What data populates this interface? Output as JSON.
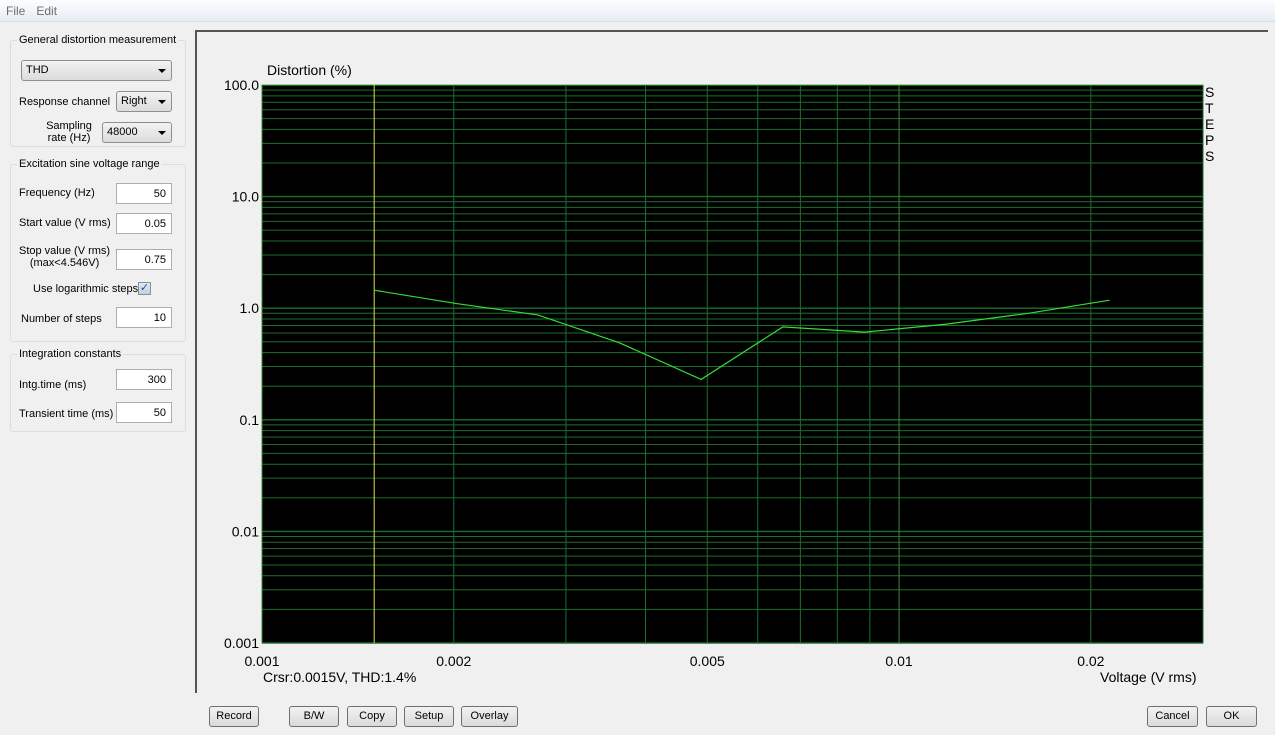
{
  "menu": [
    "File",
    "Edit"
  ],
  "general": {
    "title": "General distortion measurement",
    "mode": "THD",
    "response_label": "Response channel",
    "response_value": "Right",
    "sampling_label_1": "Sampling",
    "sampling_label_2": "rate (Hz)",
    "sampling_value": "48000"
  },
  "excitation": {
    "title": "Excitation sine voltage range",
    "freq_label": "Frequency (Hz)",
    "freq_value": "50",
    "start_label": "Start value (V rms)",
    "start_value": "0.05",
    "stop_label_1": "Stop value (V rms)",
    "stop_label_2": "(max<4.546V)",
    "stop_value": "0.75",
    "log_label": "Use logarithmic steps",
    "log_checked": true,
    "steps_label": "Number of steps",
    "steps_value": "10"
  },
  "integration": {
    "title": "Integration constants",
    "intg_label": "Intg.time (ms)",
    "intg_value": "300",
    "transient_label": "Transient time (ms)",
    "transient_value": "50"
  },
  "buttons": {
    "record": "Record",
    "bw": "B/W",
    "copy": "Copy",
    "setup": "Setup",
    "overlay": "Overlay",
    "cancel": "Cancel",
    "ok": "OK"
  },
  "plot": {
    "side_label": "STEPS",
    "cursor_text": "Crsr:0.0015V, THD:1.4%"
  },
  "chart_data": {
    "type": "line",
    "ylabel": "Distortion (%)",
    "xlabel": "Voltage (V rms)",
    "xscale": "log",
    "yscale": "log",
    "xlim": [
      0.001,
      0.03
    ],
    "ylim": [
      0.001,
      100
    ],
    "xticks": [
      "0.001",
      "0.002",
      "0.005",
      "0.01",
      "0.02"
    ],
    "yticks": [
      "100.0",
      "10.0",
      "1.0",
      "0.1",
      "0.01",
      "0.001"
    ],
    "grid": true,
    "background": "#000000",
    "line_color": "#33dd33",
    "grid_color": "#1e6e2e",
    "cursor_color": "#e0e040",
    "cursor_x": 0.0015,
    "x": [
      0.0015,
      0.00202,
      0.00271,
      0.00364,
      0.00489,
      0.00657,
      0.00883,
      0.01187,
      0.01595,
      0.0214
    ],
    "y": [
      1.45,
      1.1,
      0.87,
      0.49,
      0.23,
      0.68,
      0.61,
      0.72,
      0.9,
      1.18
    ]
  }
}
